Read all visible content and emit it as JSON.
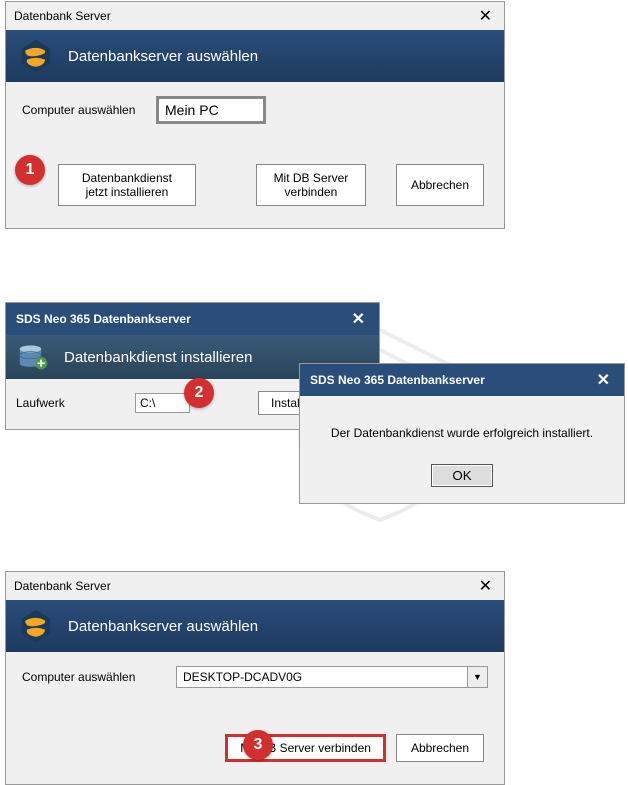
{
  "window1": {
    "title": "Datenbank Server",
    "banner": "Datenbankserver auswählen",
    "select_label": "Computer auswählen",
    "select_value": "Mein PC",
    "btn_install": "Datenbankdienst jetzt installieren",
    "btn_connect": "Mit DB Server verbinden",
    "btn_cancel": "Abbrechen"
  },
  "window2": {
    "title": "SDS Neo 365 Datenbankserver",
    "banner": "Datenbankdienst installieren",
    "drive_label": "Laufwerk",
    "drive_value": "C:\\",
    "btn_install": "Installieren"
  },
  "window3": {
    "title": "SDS Neo 365 Datenbankserver",
    "message": "Der Datenbankdienst wurde erfolgreich installiert.",
    "btn_ok": "OK"
  },
  "window4": {
    "title": "Datenbank Server",
    "banner": "Datenbankserver auswählen",
    "select_label": "Computer auswählen",
    "select_value": "DESKTOP-DCADV0G",
    "btn_connect": "Mit DB Server verbinden",
    "btn_cancel": "Abbrechen"
  },
  "badges": {
    "b1": "1",
    "b2": "2",
    "b3": "3"
  }
}
